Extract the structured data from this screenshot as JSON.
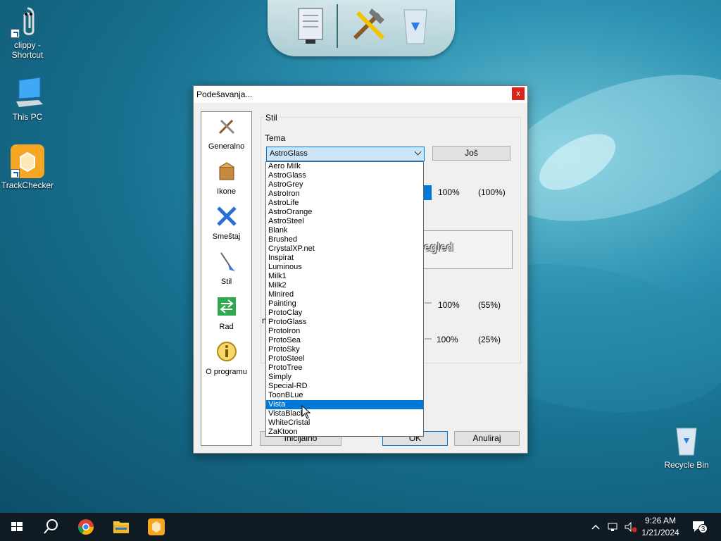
{
  "desktop": {
    "icons": [
      {
        "label": "clippy - Shortcut"
      },
      {
        "label": "This PC"
      },
      {
        "label": "TrackChecker"
      },
      {
        "label": "Recycle Bin"
      }
    ]
  },
  "dialog": {
    "title": "Podešavanja...",
    "close": "x",
    "nav": [
      {
        "label": "Generalno",
        "icon": "tools-icon"
      },
      {
        "label": "Ikone",
        "icon": "package-icon"
      },
      {
        "label": "Smeštaj",
        "icon": "move-arrows-icon"
      },
      {
        "label": "Stil",
        "icon": "brush-icon"
      },
      {
        "label": "Rad",
        "icon": "green-arrows-icon"
      },
      {
        "label": "O programu",
        "icon": "info-icon"
      }
    ],
    "group_label": "Stil",
    "theme_label": "Tema",
    "theme_selected": "AstroGlass",
    "more_button": "Još",
    "value1_pct": "100%",
    "value1_paren": "(100%)",
    "preview_text": "egled",
    "value2_pct": "100%",
    "value2_paren": "(55%)",
    "value3_pct": "100%",
    "value3_paren": "(25%)",
    "btn_default": "Inicijalno",
    "btn_ok": "OK",
    "btn_cancel": "Anuliraj",
    "theme_options": [
      "Aero Milk",
      "AstroGlass",
      "AstroGrey",
      "AstroIron",
      "AstroLife",
      "AstroOrange",
      "AstroSteel",
      "Blank",
      "Brushed",
      "CrystalXP.net",
      "Inspirat",
      "Luminous",
      "Milk1",
      "Milk2",
      "Minired",
      "Painting",
      "ProtoClay",
      "ProtoGlass",
      "ProtoIron",
      "ProtoSea",
      "ProtoSky",
      "ProtoSteel",
      "ProtoTree",
      "Simply",
      "Special-RD",
      "ToonBLue",
      "Vista",
      "VistaBlack",
      "WhiteCristal",
      "ZaKtoon"
    ],
    "highlighted_option": "Vista"
  },
  "taskbar": {
    "time": "9:26 AM",
    "date": "1/21/2024",
    "notifications": "3"
  },
  "colors": {
    "accent": "#0078d7",
    "close": "#d9241c",
    "taskbar": "#101a22"
  }
}
